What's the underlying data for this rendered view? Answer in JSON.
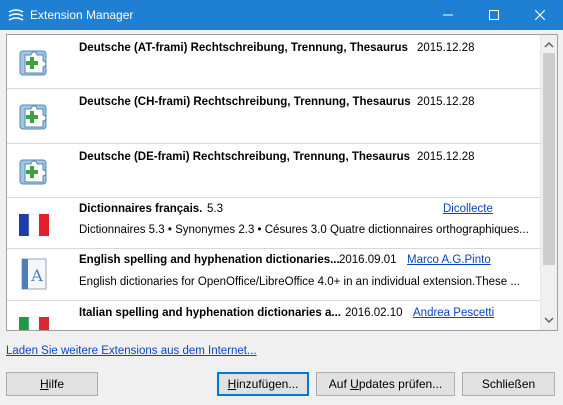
{
  "window": {
    "title": "Extension Manager"
  },
  "extensions": [
    {
      "name": "Deutsche (AT-frami) Rechtschreibung, Trennung, Thesaurus",
      "version": "2015.12.28",
      "publisher": "",
      "description": "",
      "icon": "puzzle-icon"
    },
    {
      "name": "Deutsche (CH-frami) Rechtschreibung, Trennung, Thesaurus",
      "version": "2015.12.28",
      "publisher": "",
      "description": "",
      "icon": "puzzle-icon"
    },
    {
      "name": "Deutsche (DE-frami) Rechtschreibung, Trennung, Thesaurus",
      "version": "2015.12.28",
      "publisher": "",
      "description": "",
      "icon": "puzzle-icon"
    },
    {
      "name": "Dictionnaires français.",
      "version": "5.3",
      "publisher": "Dicollecte",
      "description": "Dictionnaires 5.3 • Synonymes 2.3 • Césures 3.0  Quatre dictionnaires orthographiques...",
      "icon": "french-flag-icon"
    },
    {
      "name": "English spelling and hyphenation dictionaries...",
      "version": "2016.09.01",
      "publisher": "Marco A.G.Pinto",
      "description": "English dictionaries for OpenOffice/LibreOffice 4.0+ in an individual extension.These ...",
      "icon": "document-a-icon"
    },
    {
      "name": "Italian spelling and hyphenation dictionaries a...",
      "version": "2016.02.10",
      "publisher": "Andrea Pescetti",
      "description": "",
      "icon": "italian-flag-icon"
    }
  ],
  "more_link": "Laden Sie weitere Extensions aus dem Internet...",
  "buttons": {
    "help": "Hilfe",
    "add": "Hinzufügen...",
    "updates": "Auf Updates prüfen...",
    "close": "Schließen"
  },
  "colors": {
    "titlebar": "#1e7fd3",
    "link": "#0645c5",
    "puzzle": "#3fa044"
  }
}
